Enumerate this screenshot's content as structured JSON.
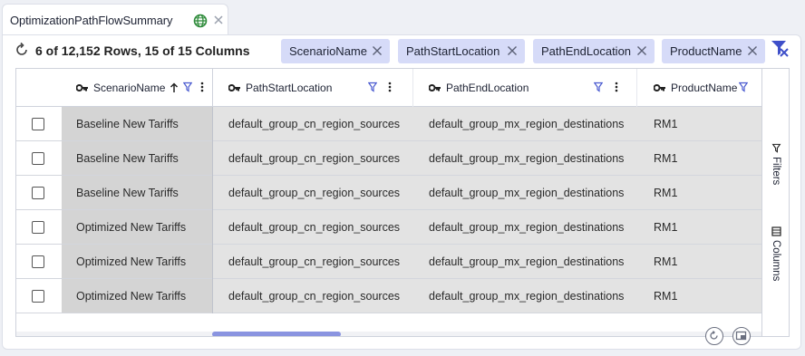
{
  "tab": {
    "title": "OptimizationPathFlowSummary",
    "globe_icon": "globe-icon",
    "close_icon": "close-icon"
  },
  "toolbar": {
    "row_count": "6 of 12,152 Rows, 15 of 15 Columns",
    "refresh_icon": "refresh-icon",
    "clear_filters_icon": "filter-clear-icon"
  },
  "group_chips": [
    {
      "label": "ScenarioName"
    },
    {
      "label": "PathStartLocation"
    },
    {
      "label": "PathEndLocation"
    },
    {
      "label": "ProductName"
    }
  ],
  "columns": [
    {
      "label": "ScenarioName",
      "sort": "ascending"
    },
    {
      "label": "PathStartLocation"
    },
    {
      "label": "PathEndLocation"
    },
    {
      "label": "ProductName"
    }
  ],
  "rows": [
    {
      "scenario": "Baseline New Tariffs",
      "start": "default_group_cn_region_sources",
      "end": "default_group_mx_region_destinations",
      "product": "RM1"
    },
    {
      "scenario": "Baseline New Tariffs",
      "start": "default_group_cn_region_sources",
      "end": "default_group_mx_region_destinations",
      "product": "RM1"
    },
    {
      "scenario": "Baseline New Tariffs",
      "start": "default_group_cn_region_sources",
      "end": "default_group_mx_region_destinations",
      "product": "RM1"
    },
    {
      "scenario": "Optimized New Tariffs",
      "start": "default_group_cn_region_sources",
      "end": "default_group_mx_region_destinations",
      "product": "RM1"
    },
    {
      "scenario": "Optimized New Tariffs",
      "start": "default_group_cn_region_sources",
      "end": "default_group_mx_region_destinations",
      "product": "RM1"
    },
    {
      "scenario": "Optimized New Tariffs",
      "start": "default_group_cn_region_sources",
      "end": "default_group_mx_region_destinations",
      "product": "RM1"
    }
  ],
  "side_panel": {
    "filters": "Filters",
    "columns": "Columns"
  },
  "colors": {
    "accent": "#8a94e0",
    "chip": "#d6dbf8",
    "row_bg": "#e3e3e3",
    "pinned_bg": "#d4d4d4"
  }
}
